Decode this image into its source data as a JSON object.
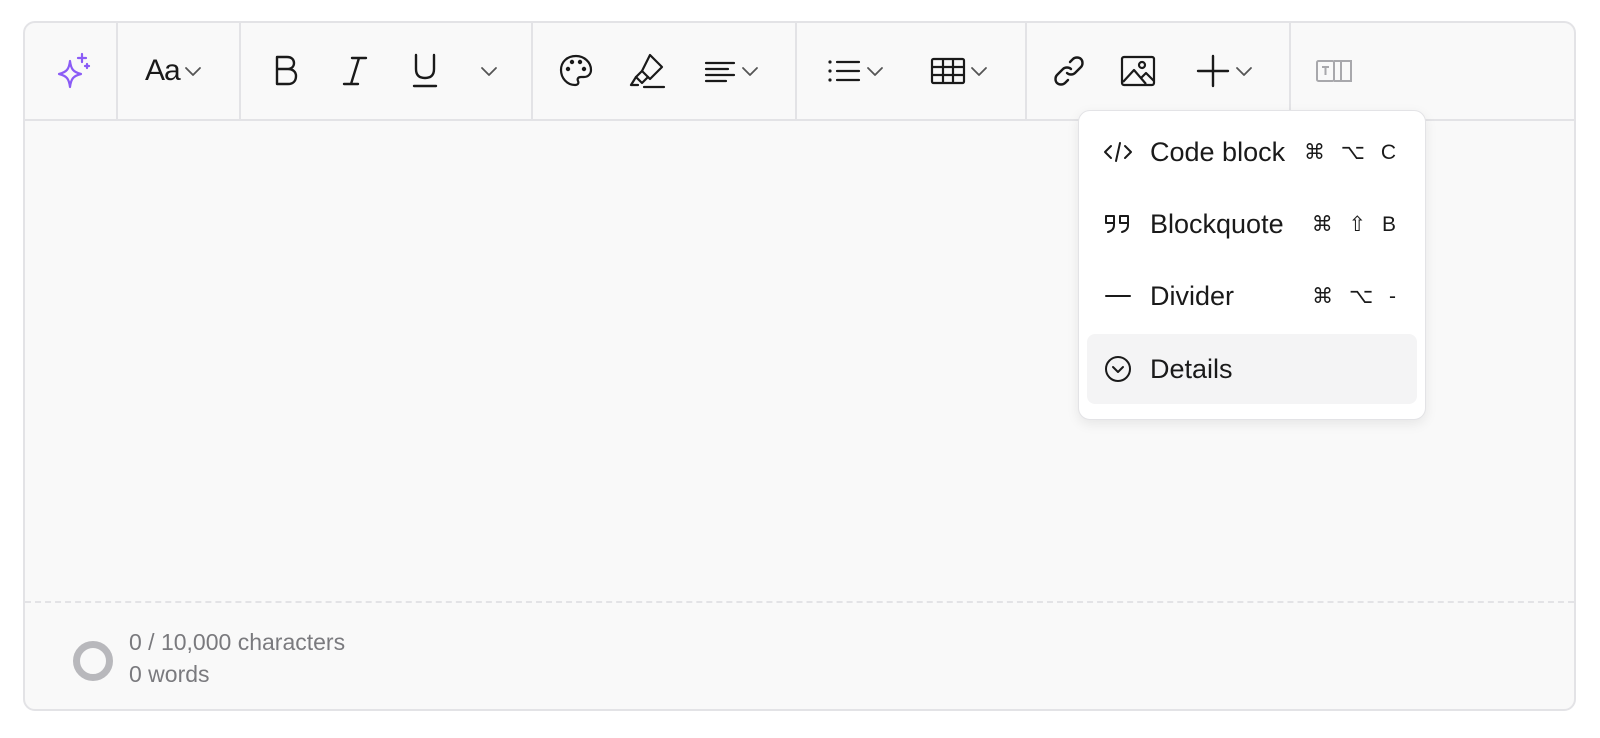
{
  "toolbar": {
    "font_button": "Aa",
    "icons": [
      "sparkles-icon",
      "bold-icon",
      "italic-icon",
      "underline-icon",
      "palette-icon",
      "highlighter-icon",
      "align-left-icon",
      "bullet-list-icon",
      "table-icon",
      "link-icon",
      "image-icon",
      "plus-icon",
      "toggle-panel-icon"
    ],
    "accent_color": "#8b5cf6"
  },
  "insert_menu": {
    "items": [
      {
        "label": "Code block",
        "shortcut": "⌘ ⌥ C",
        "icon": "code-icon"
      },
      {
        "label": "Blockquote",
        "shortcut": "⌘ ⇧ B",
        "icon": "quote-icon"
      },
      {
        "label": "Divider",
        "shortcut": "⌘ ⌥ -",
        "icon": "divider-icon"
      },
      {
        "label": "Details",
        "shortcut": "",
        "icon": "chevron-circle-icon"
      }
    ]
  },
  "footer": {
    "characters": "0 / 10,000 characters",
    "words": "0 words",
    "character_fraction": 0
  }
}
